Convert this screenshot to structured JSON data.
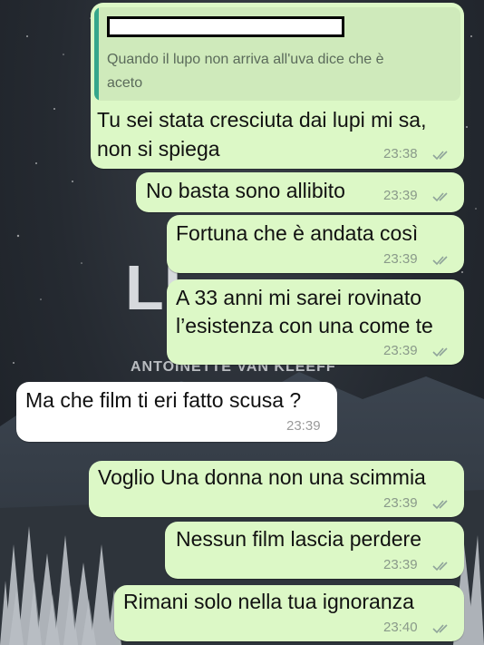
{
  "background": {
    "cover_title_fragment": "LI",
    "cover_author": "ANTOINETTE VAN KLEEFF"
  },
  "messages": [
    {
      "direction": "outgoing",
      "quote": {
        "author": "",
        "text_line1": "Quando il lupo non arriva all'uva dice che è",
        "text_line2": "aceto"
      },
      "line1": "Tu sei stata cresciuta dai lupi mi sa,",
      "line2": "non si spiega",
      "time": "23:38"
    },
    {
      "direction": "outgoing",
      "line1": "No basta sono allibito",
      "time": "23:39"
    },
    {
      "direction": "outgoing",
      "line1": "Fortuna che è andata così",
      "time": "23:39"
    },
    {
      "direction": "outgoing",
      "line1": "A 33 anni mi sarei rovinato",
      "line2": "l’esistenza con una come te",
      "time": "23:39"
    },
    {
      "direction": "incoming",
      "line1": "Ma che film ti eri fatto scusa ?",
      "time": "23:39"
    },
    {
      "direction": "outgoing",
      "line1": "Voglio Una donna non una scimmia",
      "time": "23:39"
    },
    {
      "direction": "outgoing",
      "line1": "Nessun film lascia perdere",
      "time": "23:39"
    },
    {
      "direction": "outgoing",
      "line1": "Rimani solo nella tua ignoranza",
      "time": "23:40"
    }
  ],
  "colors": {
    "outgoing_bubble": "#dcf8c6",
    "incoming_bubble": "#ffffff",
    "quote_bar": "#35a68c"
  }
}
